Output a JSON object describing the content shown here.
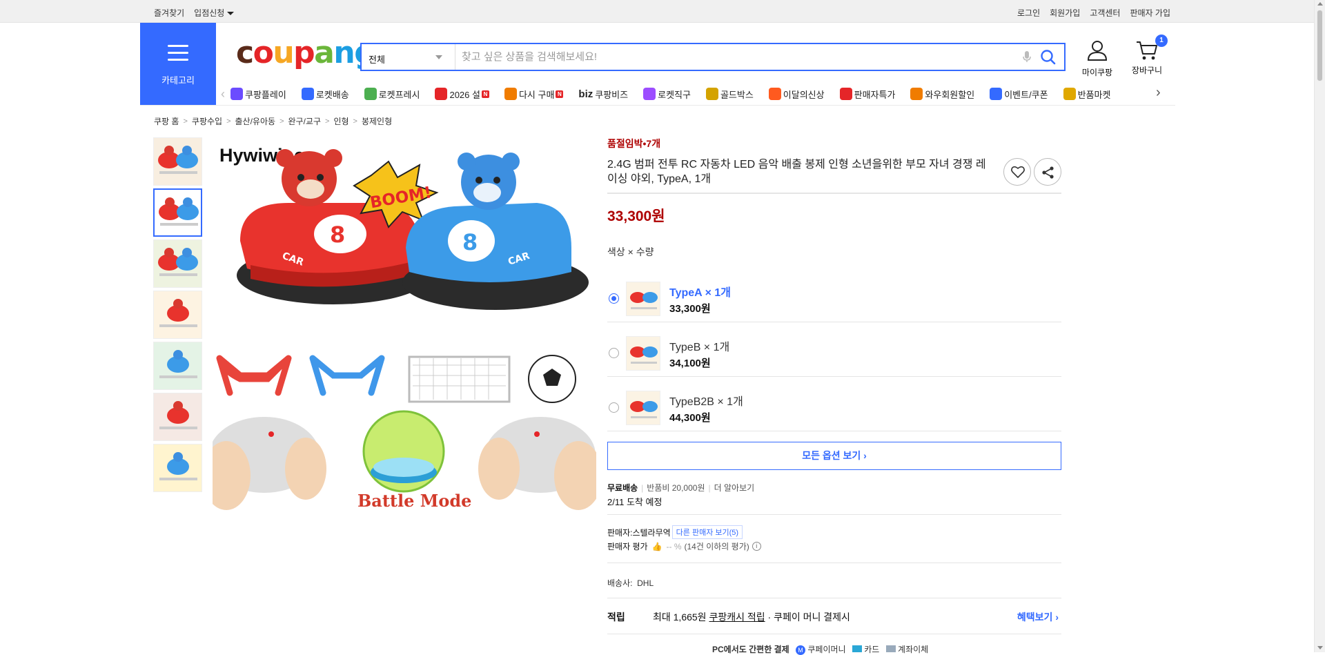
{
  "topbar": {
    "left": [
      "즐겨찾기",
      "입점신청"
    ],
    "right": [
      "로그인",
      "회원가입",
      "고객센터",
      "판매자 가입"
    ]
  },
  "category": {
    "label": "카테고리"
  },
  "logo": {
    "text": "coupang",
    "letters": [
      "c",
      "o",
      "u",
      "p",
      "a",
      "n",
      "g"
    ],
    "colors": [
      "#5a2b1a",
      "#e52528",
      "#f6a724",
      "#e52528",
      "#6bb63a",
      "#1c9ee2",
      "#1c9ee2"
    ]
  },
  "search": {
    "category": "전체",
    "placeholder": "찾고 싶은 상품을 검색해보세요!"
  },
  "user": {
    "mycoupang": "마이쿠팡",
    "cart": "장바구니",
    "cart_count": "1"
  },
  "nav": [
    {
      "label": "쿠팡플레이",
      "icon": "play-icon",
      "color": "#6b4cff"
    },
    {
      "label": "로켓배송",
      "icon": "rocket-icon",
      "color": "#346aff"
    },
    {
      "label": "로켓프레시",
      "icon": "rocket-fresh-icon",
      "color": "#4caf50"
    },
    {
      "label": "2026 설",
      "icon": "gift-icon",
      "color": "#e52528",
      "badge": "N"
    },
    {
      "label": "다시 구매",
      "icon": "rebuy-icon",
      "color": "#f07c00",
      "badge": "N"
    },
    {
      "label": "쿠팡비즈",
      "icon": "biz-icon",
      "color": "#222",
      "prefix": "biz"
    },
    {
      "label": "로켓직구",
      "icon": "global-icon",
      "color": "#9c4dff"
    },
    {
      "label": "골드박스",
      "icon": "goldbox-icon",
      "color": "#d4a300"
    },
    {
      "label": "이달의신상",
      "icon": "new-icon",
      "color": "#ff5a1f"
    },
    {
      "label": "판매자특가",
      "icon": "discount-icon",
      "color": "#e52528"
    },
    {
      "label": "와우회원할인",
      "icon": "wow-icon",
      "color": "#f07c00"
    },
    {
      "label": "이벤트/쿠폰",
      "icon": "coupon-icon",
      "color": "#346aff"
    },
    {
      "label": "반품마켓",
      "icon": "return-market-icon",
      "color": "#e0a800"
    }
  ],
  "breadcrumb": [
    "쿠팡 홈",
    "쿠팡수입",
    "출산/유아동",
    "완구/교구",
    "인형",
    "봉제인형"
  ],
  "product": {
    "soldout": "품절임박•7개",
    "title": "2.4G 범퍼 전투 RC 자동차 LED 음악 배출 봉제 인형 소년을위한 부모 자녀 경쟁 레이싱 야외, TypeA, 1개",
    "price": "33,300원",
    "option_label": "색상 × 수량",
    "options": [
      {
        "name": "TypeA × 1개",
        "price": "33,300원",
        "selected": true
      },
      {
        "name": "TypeB × 1개",
        "price": "34,100원",
        "selected": false
      },
      {
        "name": "TypeB2B × 1개",
        "price": "44,300원",
        "selected": false
      }
    ],
    "all_options": "모든 옵션 보기 ›",
    "image_text": {
      "brand": "Hywiwine",
      "boom": "BOOM!",
      "mode": "Battle Mode",
      "car": "CAR",
      "number": "8"
    }
  },
  "shipping": {
    "free": "무료배송",
    "return_fee": "반품비 20,000원",
    "learn_more": "더 알아보기",
    "arrival": "2/11 도착 예정"
  },
  "seller": {
    "label": "판매자:",
    "name": "스텔라무역",
    "other": "다른 판매자 보기(5)",
    "rating_label": "판매자 평가",
    "rating_value": "-- %",
    "rating_note": "(14건 이하의 평가)"
  },
  "carrier": {
    "label": "배송사:",
    "name": "DHL"
  },
  "reward": {
    "label": "적립",
    "prefix": "최대 1,665원",
    "link": "쿠팡캐시 적립",
    "suffix": "· 쿠페이 머니 결제시",
    "more": "혜택보기 ›"
  },
  "pay": {
    "title": "PC에서도 간편한 결제",
    "money": "쿠페이머니",
    "card": "카드",
    "bank": "계좌이체"
  }
}
